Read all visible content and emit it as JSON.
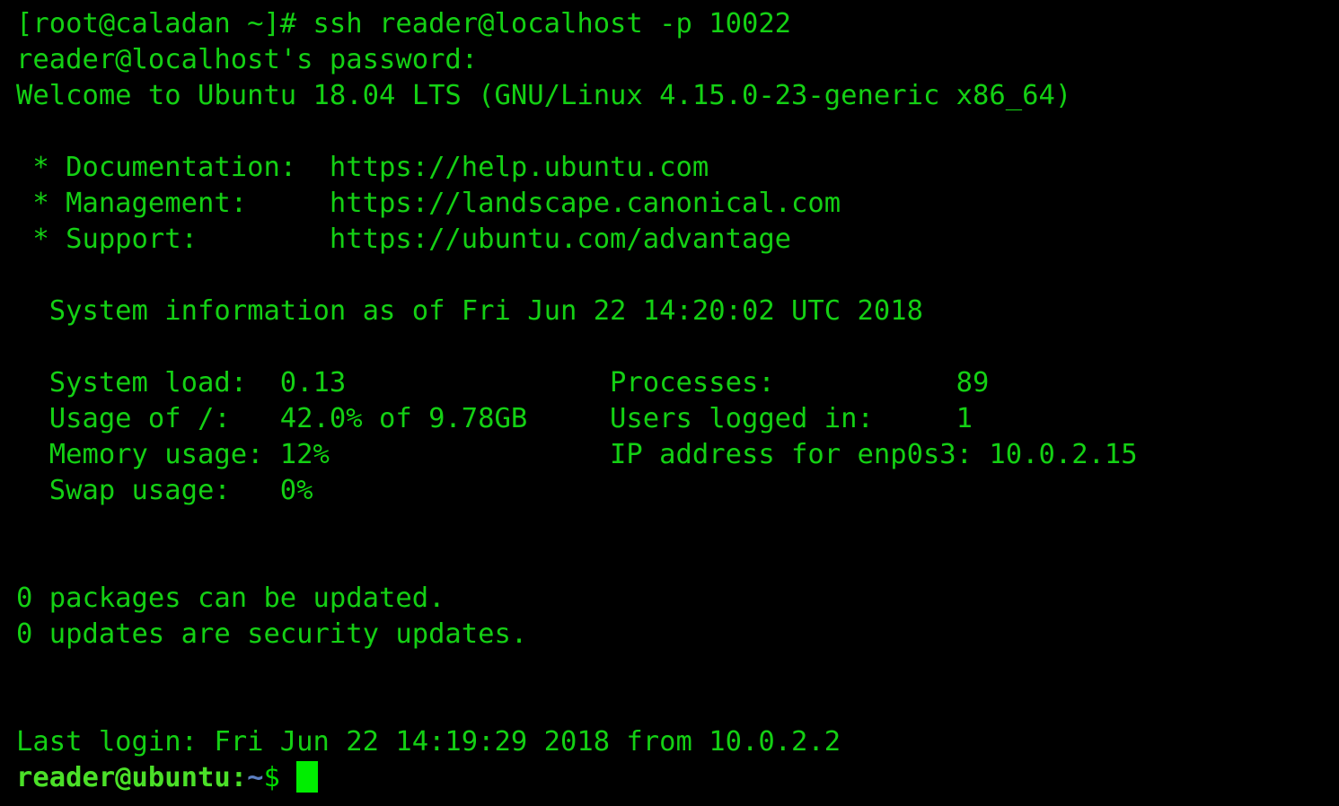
{
  "terminal": {
    "title": "ssh session",
    "colors": {
      "background": "#000000",
      "foreground": "#14d014",
      "prompt_user_host": "#4be028",
      "prompt_path": "#5c7ec0",
      "prompt_sigil": "#00dd00",
      "cursor": "#00ee00"
    },
    "local_prompt": "[root@caladan ~]#",
    "command": " ssh reader@localhost -p 10022",
    "password_prompt": "reader@localhost's password:",
    "welcome": "Welcome to Ubuntu 18.04 LTS (GNU/Linux 4.15.0-23-generic x86_64)",
    "links": [
      " * Documentation:  https://help.ubuntu.com",
      " * Management:     https://landscape.canonical.com",
      " * Support:        https://ubuntu.com/advantage"
    ],
    "sysinfo_header": "  System information as of Fri Jun 22 14:20:02 UTC 2018",
    "sysinfo_rows": [
      "  System load:  0.13                Processes:           89",
      "  Usage of /:   42.0% of 9.78GB     Users logged in:     1",
      "  Memory usage: 12%                 IP address for enp0s3: 10.0.2.15",
      "  Swap usage:   0%"
    ],
    "sysinfo_fields": {
      "system_load_label": "System load:",
      "system_load_value": "0.13",
      "usage_of_root_label": "Usage of /:",
      "usage_of_root_value": "42.0% of 9.78GB",
      "memory_usage_label": "Memory usage:",
      "memory_usage_value": "12%",
      "swap_usage_label": "Swap usage:",
      "swap_usage_value": "0%",
      "processes_label": "Processes:",
      "processes_value": "89",
      "users_logged_in_label": "Users logged in:",
      "users_logged_in_value": "1",
      "ip_address_label": "IP address for enp0s3:",
      "ip_address_value": "10.0.2.15"
    },
    "packages_line": "0 packages can be updated.",
    "security_line": "0 updates are security updates.",
    "last_login": "Last login: Fri Jun 22 14:19:29 2018 from 10.0.2.2",
    "prompt": {
      "user_host": "reader@ubuntu",
      "colon": ":",
      "path": "~",
      "sigil": "$",
      "space": " "
    }
  }
}
